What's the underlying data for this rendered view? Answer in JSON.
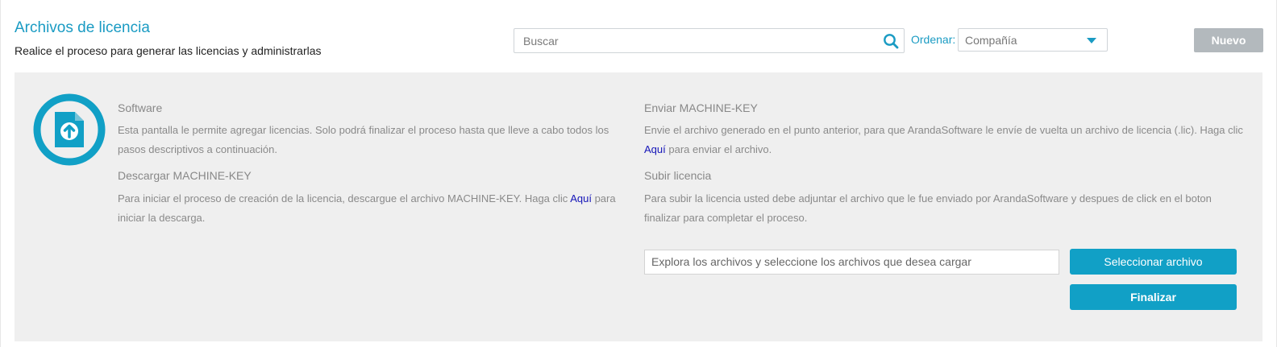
{
  "header": {
    "title": "Archivos de licencia",
    "subtitle": "Realice el proceso para generar las licencias y administrarlas"
  },
  "search": {
    "placeholder": "Buscar",
    "icon": "search-icon"
  },
  "sort": {
    "label": "Ordenar:",
    "selected": "Compañía"
  },
  "toolbar": {
    "new_label": "Nuevo"
  },
  "steps": {
    "software": {
      "title": "Software",
      "text": "Esta pantalla le permite agregar licencias. Solo podrá finalizar el proceso hasta que lleve a cabo todos los pasos descriptivos a continuación."
    },
    "download": {
      "title": "Descargar MACHINE-KEY",
      "text_before": "Para iniciar el proceso de creación de la licencia, descargue el archivo MACHINE-KEY. Haga clic ",
      "link": "Aquí",
      "text_after": " para iniciar la descarga."
    },
    "send": {
      "title": "Enviar MACHINE-KEY",
      "text_before": "Envie el archivo generado en el punto anterior, para que ArandaSoftware le envíe de vuelta un archivo de licencia (.lic). Haga clic ",
      "link": "Aquí",
      "text_after": " para enviar el archivo."
    },
    "upload": {
      "title": "Subir licencia",
      "text": "Para subir la licencia usted debe adjuntar el archivo que le fue enviado por ArandaSoftware y despues de click en el boton finalizar para completar el proceso."
    }
  },
  "file_upload": {
    "placeholder": "Explora los archivos y seleccione los archivos que desea cargar",
    "select_label": "Seleccionar archivo",
    "finish_label": "Finalizar"
  },
  "colors": {
    "accent": "#1a9bc3",
    "button": "#11a0c6",
    "disabled": "#b3b9bd",
    "panel": "#efefef"
  }
}
